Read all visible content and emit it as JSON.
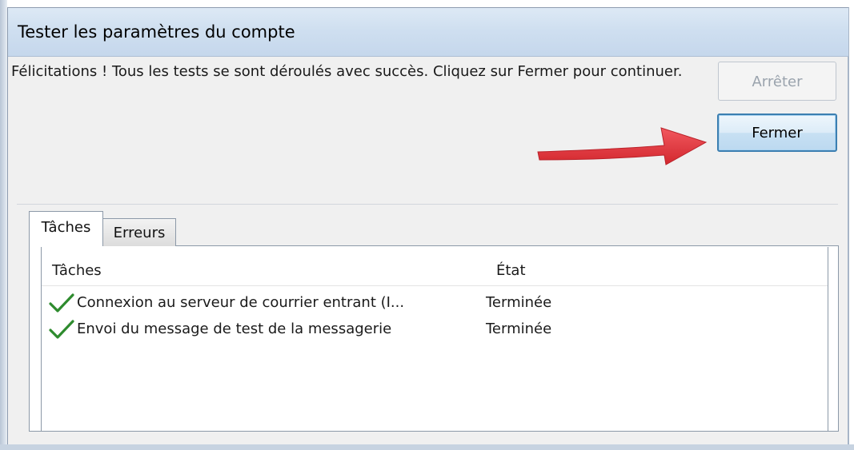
{
  "window": {
    "title": "Tester les paramètres du compte"
  },
  "message": {
    "text": "Félicitations ! Tous les tests se sont déroulés avec succès. Cliquez sur Fermer pour continuer."
  },
  "buttons": {
    "stop_label": "Arrêter",
    "close_label": "Fermer"
  },
  "tabs": [
    {
      "label": "Tâches",
      "selected": true
    },
    {
      "label": "Erreurs",
      "selected": false
    }
  ],
  "table": {
    "columns": [
      "Tâches",
      "État"
    ],
    "rows": [
      {
        "status_icon": "check-icon",
        "task": "Connexion au serveur de courrier entrant (I...",
        "state": "Terminée"
      },
      {
        "status_icon": "check-icon",
        "task": "Envoi du message de test de la messagerie",
        "state": "Terminée"
      }
    ]
  },
  "colors": {
    "accent_arrow": "#e8262d",
    "check_green": "#2e8b2e",
    "default_button_border": "#3c7fb1"
  }
}
